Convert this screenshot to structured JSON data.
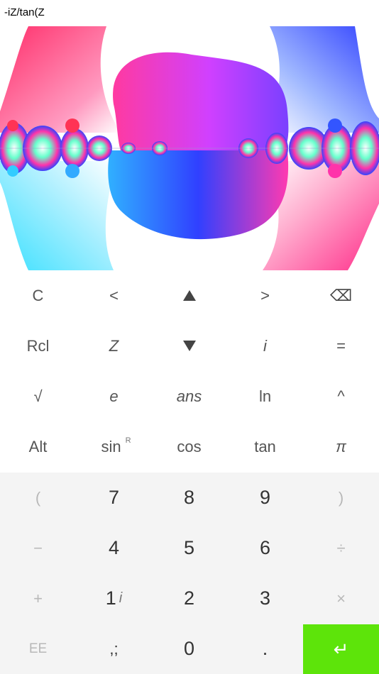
{
  "expression": "-iZ/tan(Z",
  "keys_top": {
    "row1": [
      "C",
      "<",
      "up-triangle-icon",
      ">",
      "backspace-icon"
    ],
    "row1_labels": {
      "clear": "C",
      "left": "<",
      "right": ">",
      "backspace": "⌫"
    },
    "row2": {
      "rcl": "Rcl",
      "z": "Z",
      "i": "i",
      "equals": "="
    },
    "row3": {
      "sqrt": "√",
      "e": "e",
      "ans": "ans",
      "ln": "ln",
      "pow": "^"
    },
    "row4": {
      "alt": "Alt",
      "sin": "sin",
      "sin_sup": "R",
      "cos": "cos",
      "tan": "tan",
      "pi": "π"
    }
  },
  "keys_bottom": {
    "row1": {
      "lparen": "(",
      "seven": "7",
      "eight": "8",
      "nine": "9",
      "rparen": ")"
    },
    "row2": {
      "minus": "−",
      "four": "4",
      "five": "5",
      "six": "6",
      "divide": "÷"
    },
    "row3": {
      "plus": "+",
      "one": "1",
      "one_sub": "i",
      "two": "2",
      "three": "3",
      "times": "×"
    },
    "row4": {
      "ee": "EE",
      "sep": ",;",
      "zero": "0",
      "dot": ".",
      "enter": "↵"
    }
  },
  "colors": {
    "enter_bg": "#5de40a",
    "bottom_bg": "#f4f4f4"
  }
}
